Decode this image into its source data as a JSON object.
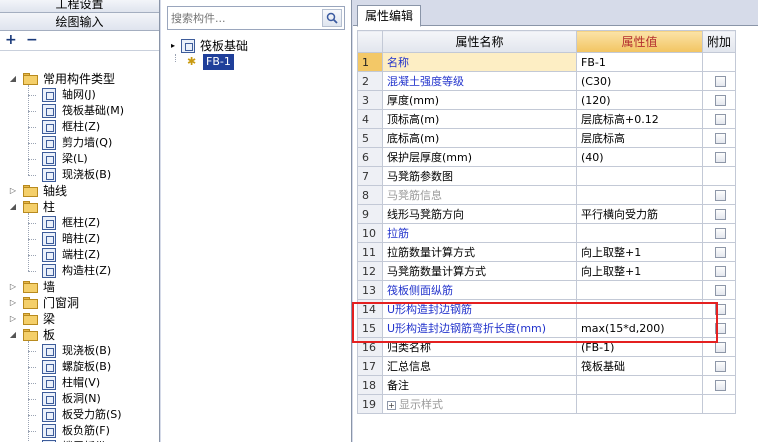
{
  "left": {
    "header_top": "工程设置",
    "header_main": "绘图输入",
    "tree": [
      {
        "label": "常用构件类型",
        "kind": "folder",
        "level": 0,
        "open": true
      },
      {
        "label": "轴网(J)",
        "kind": "item",
        "level": 1,
        "icon": "grid-icon"
      },
      {
        "label": "筏板基础(M)",
        "kind": "item",
        "level": 1,
        "icon": "raft-icon"
      },
      {
        "label": "框柱(Z)",
        "kind": "item",
        "level": 1,
        "icon": "column-icon"
      },
      {
        "label": "剪力墙(Q)",
        "kind": "item",
        "level": 1,
        "icon": "wall-icon"
      },
      {
        "label": "梁(L)",
        "kind": "item",
        "level": 1,
        "icon": "beam-icon"
      },
      {
        "label": "现浇板(B)",
        "kind": "item",
        "level": 1,
        "icon": "slab-icon"
      },
      {
        "label": "轴线",
        "kind": "folder",
        "level": 0,
        "open": false
      },
      {
        "label": "柱",
        "kind": "folder",
        "level": 0,
        "open": true
      },
      {
        "label": "框柱(Z)",
        "kind": "item",
        "level": 1,
        "icon": "column-icon"
      },
      {
        "label": "暗柱(Z)",
        "kind": "item",
        "level": 1,
        "icon": "column-icon"
      },
      {
        "label": "端柱(Z)",
        "kind": "item",
        "level": 1,
        "icon": "column-icon"
      },
      {
        "label": "构造柱(Z)",
        "kind": "item",
        "level": 1,
        "icon": "column-icon"
      },
      {
        "label": "墙",
        "kind": "folder",
        "level": 0,
        "open": false
      },
      {
        "label": "门窗洞",
        "kind": "folder",
        "level": 0,
        "open": false
      },
      {
        "label": "梁",
        "kind": "folder",
        "level": 0,
        "open": false
      },
      {
        "label": "板",
        "kind": "folder",
        "level": 0,
        "open": true
      },
      {
        "label": "现浇板(B)",
        "kind": "item",
        "level": 1,
        "icon": "slab-icon"
      },
      {
        "label": "螺旋板(B)",
        "kind": "item",
        "level": 1,
        "icon": "spiral-icon"
      },
      {
        "label": "柱帽(V)",
        "kind": "item",
        "level": 1,
        "icon": "cap-icon"
      },
      {
        "label": "板洞(N)",
        "kind": "item",
        "level": 1,
        "icon": "hole-icon"
      },
      {
        "label": "板受力筋(S)",
        "kind": "item",
        "level": 1,
        "icon": "rebar-icon"
      },
      {
        "label": "板负筋(F)",
        "kind": "item",
        "level": 1,
        "icon": "rebar-icon"
      },
      {
        "label": "楼层板带(H)",
        "kind": "item",
        "level": 1,
        "icon": "band-icon"
      }
    ]
  },
  "middle": {
    "search_placeholder": "搜索构件...",
    "root_label": "筏板基础",
    "selected_label": "FB-1"
  },
  "right": {
    "tab_label": "属性编辑",
    "col_name": "属性名称",
    "col_value": "属性值",
    "col_extra": "附加",
    "rows": [
      {
        "num": "1",
        "name": "名称",
        "value": "FB-1",
        "style": "hl",
        "cb": false
      },
      {
        "num": "2",
        "name": "混凝土强度等级",
        "value": "(C30)",
        "style": "blue",
        "cb": true
      },
      {
        "num": "3",
        "name": "厚度(mm)",
        "value": "(120)",
        "style": "",
        "cb": true
      },
      {
        "num": "4",
        "name": "顶标高(m)",
        "value": "层底标高+0.12",
        "style": "",
        "cb": true
      },
      {
        "num": "5",
        "name": "底标高(m)",
        "value": "层底标高",
        "style": "",
        "cb": true
      },
      {
        "num": "6",
        "name": "保护层厚度(mm)",
        "value": "(40)",
        "style": "",
        "cb": true
      },
      {
        "num": "7",
        "name": "马凳筋参数图",
        "value": "",
        "style": "",
        "cb": false
      },
      {
        "num": "8",
        "name": "马凳筋信息",
        "value": "",
        "style": "gray",
        "cb": true
      },
      {
        "num": "9",
        "name": "线形马凳筋方向",
        "value": "平行横向受力筋",
        "style": "",
        "cb": true
      },
      {
        "num": "10",
        "name": "拉筋",
        "value": "",
        "style": "blue",
        "cb": true
      },
      {
        "num": "11",
        "name": "拉筋数量计算方式",
        "value": "向上取整+1",
        "style": "",
        "cb": true
      },
      {
        "num": "12",
        "name": "马凳筋数量计算方式",
        "value": "向上取整+1",
        "style": "",
        "cb": true
      },
      {
        "num": "13",
        "name": "筏板侧面纵筋",
        "value": "",
        "style": "blue",
        "cb": true
      },
      {
        "num": "14",
        "name": "U形构造封边钢筋",
        "value": "",
        "style": "blue",
        "cb": true
      },
      {
        "num": "15",
        "name": "U形构造封边钢筋弯折长度(mm)",
        "value": "max(15*d,200)",
        "style": "blue",
        "cb": true
      },
      {
        "num": "16",
        "name": "归类名称",
        "value": "(FB-1)",
        "style": "",
        "cb": true
      },
      {
        "num": "17",
        "name": "汇总信息",
        "value": "筏板基础",
        "style": "",
        "cb": true
      },
      {
        "num": "18",
        "name": "备注",
        "value": "",
        "style": "",
        "cb": true
      },
      {
        "num": "19",
        "name": "显示样式",
        "value": "",
        "style": "gray",
        "cb": false
      }
    ]
  }
}
